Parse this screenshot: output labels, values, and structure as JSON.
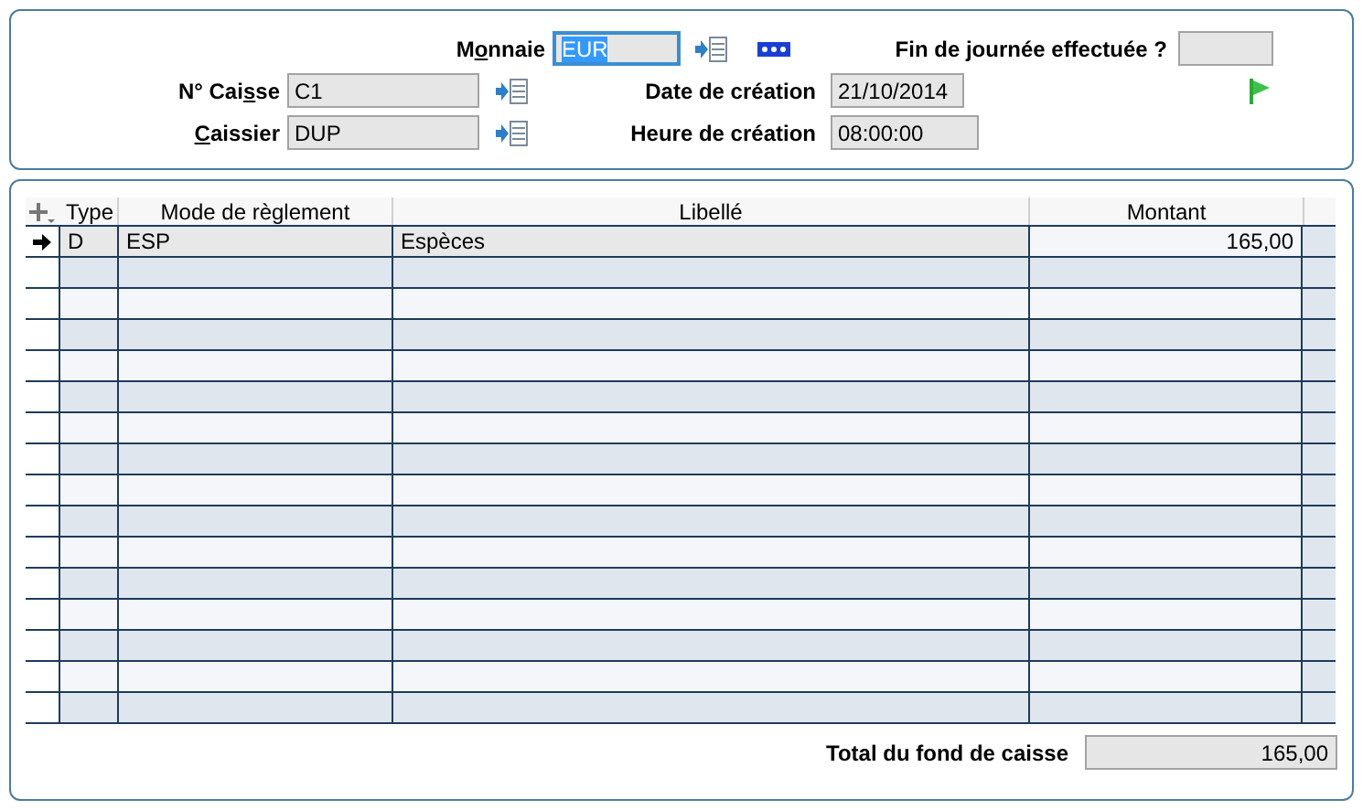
{
  "header": {
    "currency": {
      "label": {
        "before": "M",
        "key": "o",
        "after": "nnaie"
      },
      "value": "EUR",
      "focused": true
    },
    "register": {
      "label": {
        "before": "N° Cai",
        "key": "s",
        "after": "se"
      },
      "value": "C1"
    },
    "cashier": {
      "label": {
        "key": "C",
        "after": "aissier"
      },
      "value": "DUP"
    },
    "end_of_day": {
      "label": "Fin de journée effectuée ?"
    },
    "creation_date": {
      "label": "Date de création",
      "value": "21/10/2014"
    },
    "creation_time": {
      "label": "Heure de création",
      "value": "08:00:00"
    }
  },
  "table": {
    "columns": [
      "Type",
      "Mode de règlement",
      "Libellé",
      "Montant"
    ],
    "rows": [
      {
        "type": "D",
        "mode": "ESP",
        "label": "Espèces",
        "amount": "165,00",
        "selected": true
      }
    ]
  },
  "total": {
    "label": "Total du fond de caisse",
    "value": "165,00"
  }
}
